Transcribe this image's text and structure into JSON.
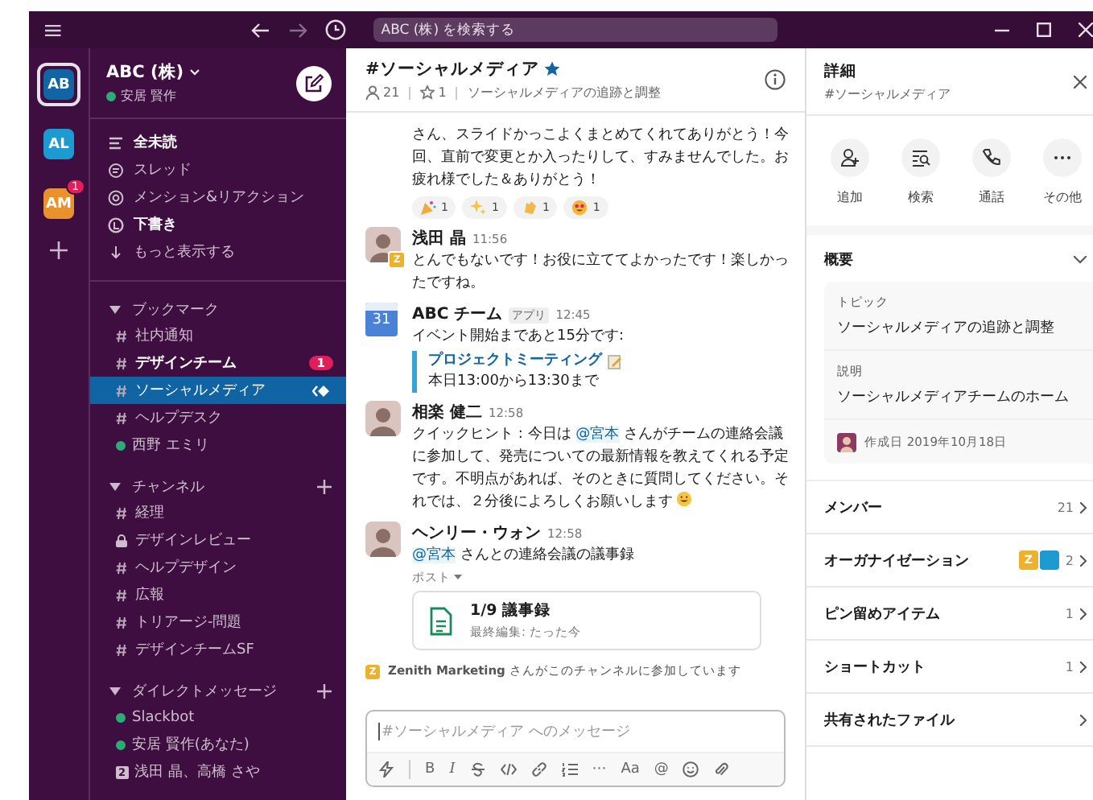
{
  "top_bar": {
    "search_placeholder": "ABC (株) を検索する"
  },
  "workspaces": [
    {
      "label": "AB",
      "color": "#1264a3",
      "selected": true
    },
    {
      "label": "AL",
      "color": "#1d9bd1",
      "selected": false
    },
    {
      "label": "AM",
      "color": "#e8912d",
      "selected": false,
      "badge": "1"
    }
  ],
  "sidebar": {
    "workspace": "ABC (株)",
    "user": "安居 賢作",
    "nav": [
      {
        "kind": "unreads",
        "label": "全未読",
        "bold": true
      },
      {
        "kind": "threads",
        "label": "スレッド",
        "bold": false
      },
      {
        "kind": "mentions",
        "label": "メンション&リアクション",
        "bold": false
      },
      {
        "kind": "drafts",
        "label": "下書き",
        "bold": true
      },
      {
        "kind": "more",
        "label": "もっと表示する",
        "bold": false
      }
    ],
    "sections": [
      {
        "title": "ブックマーク",
        "expanded": true,
        "add": false,
        "items": [
          {
            "kind": "channel",
            "label": "社内通知",
            "selected": false,
            "bold": false
          },
          {
            "kind": "channel",
            "label": "デザインチーム",
            "selected": false,
            "bold": true,
            "badge": "1"
          },
          {
            "kind": "channel",
            "label": "ソーシャルメディア",
            "selected": true,
            "bold": false,
            "shared": true
          },
          {
            "kind": "channel",
            "label": "ヘルプデスク",
            "selected": false,
            "bold": false
          },
          {
            "kind": "dm",
            "label": "西野 エミリ",
            "selected": false,
            "bold": false,
            "online": true
          }
        ]
      },
      {
        "title": "チャンネル",
        "expanded": true,
        "add": true,
        "items": [
          {
            "kind": "channel",
            "label": "経理",
            "selected": false,
            "bold": false
          },
          {
            "kind": "private",
            "label": "デザインレビュー",
            "selected": false,
            "bold": false
          },
          {
            "kind": "channel",
            "label": "ヘルプデザイン",
            "selected": false,
            "bold": false
          },
          {
            "kind": "channel",
            "label": "広報",
            "selected": false,
            "bold": false
          },
          {
            "kind": "channel",
            "label": "トリアージ-問題",
            "selected": false,
            "bold": false
          },
          {
            "kind": "channel",
            "label": "デザインチームSF",
            "selected": false,
            "bold": false
          }
        ]
      },
      {
        "title": "ダイレクトメッセージ",
        "expanded": true,
        "add": true,
        "items": [
          {
            "kind": "dm",
            "label": "Slackbot",
            "selected": false,
            "bold": false,
            "online": true
          },
          {
            "kind": "dm",
            "label": "安居 賢作(あなた)",
            "selected": false,
            "bold": false,
            "online": true
          },
          {
            "kind": "group",
            "count": "2",
            "label": "浅田 晶、高橋 さや",
            "selected": false,
            "bold": false
          }
        ]
      }
    ]
  },
  "channel": {
    "title": "#ソーシャルメディア",
    "starred": true,
    "members": "21",
    "pins": "1",
    "topic": "ソーシャルメディアの追跡と調整"
  },
  "messages": [
    {
      "kind": "continuation",
      "parts": [
        {
          "text": "さん、スライドかっこよくまとめてくれてありがとう！今回、直前で変更とか入ったりして、すみませんでした。お疲れ様でした＆ありがとう！"
        }
      ],
      "reactions": [
        {
          "kind": "party",
          "count": "1"
        },
        {
          "kind": "sparkles",
          "count": "1"
        },
        {
          "kind": "clap",
          "count": "1"
        },
        {
          "kind": "heart_eyes",
          "count": "1"
        }
      ]
    },
    {
      "kind": "message",
      "avatar": {
        "kind": "person"
      },
      "author": "浅田 晶",
      "time": "11:56",
      "status_badge": "Z",
      "parts": [
        {
          "text": "とんでもないです！お役に立ててよかったです！楽しかったですね。"
        }
      ]
    },
    {
      "kind": "message",
      "avatar": {
        "kind": "calendar",
        "text": "31"
      },
      "author": "ABC チーム",
      "app_tag": "アプリ",
      "time": "12:45",
      "parts": [
        {
          "text": "イベント開始まであと15分です:"
        }
      ],
      "attachment": {
        "title": "プロジェクトミーティング",
        "detail": "本日13:00から13:30まで"
      }
    },
    {
      "kind": "message",
      "avatar": {
        "kind": "person"
      },
      "author": "相楽 健二",
      "time": "12:58",
      "parts": [
        {
          "text": "クイックヒント : 今日は "
        },
        {
          "text": "@宮本",
          "mention": true
        },
        {
          "text": " さんがチームの連絡会議に参加して、発売についての最新情報を教えてくれる予定です。不明点があれば、そのときに質問してください。それでは、２分後によろしくお願いします"
        }
      ],
      "trailing_emoji": {
        "kind": "sweat_smile"
      }
    },
    {
      "kind": "message",
      "avatar": {
        "kind": "person"
      },
      "author": "ヘンリー・ウォン",
      "time": "12:58",
      "parts": [
        {
          "text": "@宮本",
          "mention": true
        },
        {
          "text": " さんとの連絡会議の議事録"
        }
      ],
      "post_label": "ポスト",
      "file": {
        "title": "1/9 議事録",
        "subtitle": "最終編集: たった今"
      }
    }
  ],
  "system_note": {
    "badge": "Z",
    "text": "**Zenith Marketing** さんがこのチャンネルに参加しています"
  },
  "composer": {
    "placeholder": "#ソーシャルメディア へのメッセージ",
    "tools": [
      {
        "kind": "shortcut"
      },
      {
        "kind": "text",
        "label": "B"
      },
      {
        "kind": "italic",
        "label": "I"
      },
      {
        "kind": "strike"
      },
      {
        "kind": "code"
      },
      {
        "kind": "link"
      },
      {
        "kind": "list"
      },
      {
        "kind": "text",
        "label": "⋯"
      },
      {
        "kind": "text",
        "label": "Aa"
      },
      {
        "kind": "text",
        "label": "@"
      },
      {
        "kind": "emoji"
      },
      {
        "kind": "attach"
      }
    ]
  },
  "details": {
    "title": "詳細",
    "subtitle": "#ソーシャルメディア",
    "actions": [
      {
        "kind": "add",
        "label": "追加"
      },
      {
        "kind": "search",
        "label": "検索"
      },
      {
        "kind": "call",
        "label": "通話"
      },
      {
        "kind": "more",
        "label": "その他"
      }
    ],
    "about": {
      "title": "概要",
      "expanded": true,
      "topic_label": "トピック",
      "topic": "ソーシャルメディアの追跡と調整",
      "description_label": "説明",
      "description": "ソーシャルメディアチームのホーム",
      "created": "作成日 2019年10月18日"
    },
    "rows": [
      {
        "label": "メンバー",
        "count": "21"
      },
      {
        "label": "オーガナイゼーション",
        "count": "2",
        "orgs": [
          {
            "label": "Z",
            "color": "#ecb22e"
          },
          {
            "color": "#1d9bd1"
          }
        ]
      },
      {
        "label": "ピン留めアイテム",
        "count": "1"
      },
      {
        "label": "ショートカット",
        "count": "1"
      },
      {
        "label": "共有されたファイル"
      }
    ]
  }
}
